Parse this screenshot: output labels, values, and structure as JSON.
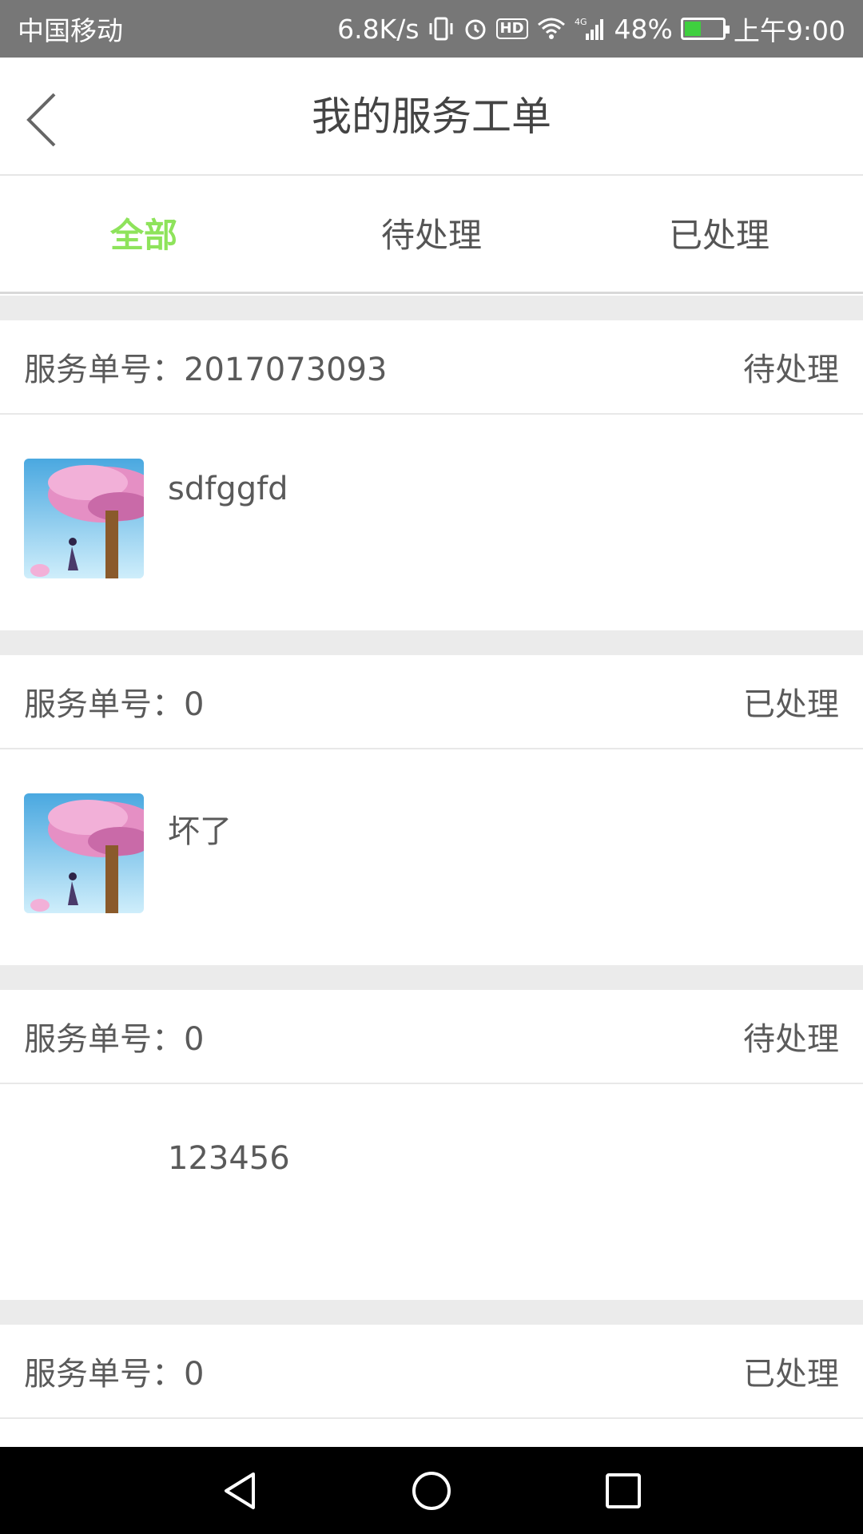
{
  "statusbar": {
    "carrier": "中国移动",
    "speed": "6.8K/s",
    "network": "4G",
    "battery": "48%",
    "battery_level": 0.48,
    "time": "上午9:00",
    "hd": "HD"
  },
  "header": {
    "title": "我的服务工单"
  },
  "tabs": [
    {
      "label": "全部",
      "active": true
    },
    {
      "label": "待处理",
      "active": false
    },
    {
      "label": "已处理",
      "active": false
    }
  ],
  "colors": {
    "accent": "#8ee35b",
    "divider": "#ebebeb"
  },
  "orders": [
    {
      "prefix": "服务单号：",
      "number": "2017073093",
      "status": "待处理",
      "description": "sdfggfd",
      "has_image": true
    },
    {
      "prefix": "服务单号：",
      "number": "0",
      "status": "已处理",
      "description": "坏了",
      "has_image": true
    },
    {
      "prefix": "服务单号：",
      "number": "0",
      "status": "待处理",
      "description": "123456",
      "has_image": false
    },
    {
      "prefix": "服务单号：",
      "number": "0",
      "status": "已处理"
    }
  ]
}
